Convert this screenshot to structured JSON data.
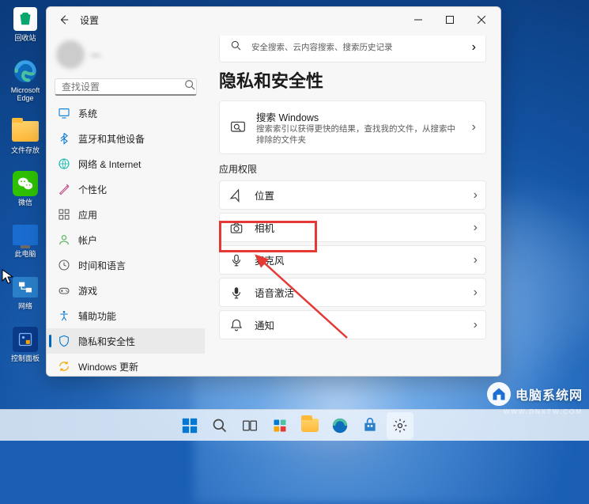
{
  "desktop": {
    "icons": [
      {
        "id": "recycle-bin",
        "label": "回收站"
      },
      {
        "id": "edge",
        "label": "Microsoft\nEdge"
      },
      {
        "id": "file-store",
        "label": "文件存放"
      },
      {
        "id": "wechat",
        "label": "微信"
      },
      {
        "id": "this-pc",
        "label": "此电脑"
      },
      {
        "id": "network",
        "label": "网络"
      },
      {
        "id": "control-panel",
        "label": "控制面板"
      }
    ]
  },
  "window": {
    "title": "设置",
    "search_placeholder": "查找设置",
    "user_name": "—",
    "nav": [
      {
        "icon": "system",
        "label": "系统",
        "color": "#0078d4"
      },
      {
        "icon": "bluetooth",
        "label": "蓝牙和其他设备",
        "color": "#0078d4"
      },
      {
        "icon": "network",
        "label": "网络 & Internet",
        "color": "#00b8a9"
      },
      {
        "icon": "personalize",
        "label": "个性化",
        "color": "#c04b8a"
      },
      {
        "icon": "apps",
        "label": "应用",
        "color": "#5b5b5b"
      },
      {
        "icon": "accounts",
        "label": "帐户",
        "color": "#4caf50"
      },
      {
        "icon": "time",
        "label": "时间和语言",
        "color": "#5b5b5b"
      },
      {
        "icon": "gaming",
        "label": "游戏",
        "color": "#5b5b5b"
      },
      {
        "icon": "accessibility",
        "label": "辅助功能",
        "color": "#0078d4"
      },
      {
        "icon": "privacy",
        "label": "隐私和安全性",
        "color": "#0078d4",
        "active": true
      },
      {
        "icon": "update",
        "label": "Windows 更新",
        "color": "#f7a500"
      }
    ],
    "page_title": "隐私和安全性",
    "top_snippet": "安全搜索、云内容搜索、搜索历史记录",
    "search_card": {
      "title": "搜索 Windows",
      "desc": "搜索索引以获得更快的结果，查找我的文件，从搜索中排除的文件夹"
    },
    "section_label": "应用权限",
    "permissions": [
      {
        "icon": "location",
        "label": "位置"
      },
      {
        "icon": "camera",
        "label": "相机"
      },
      {
        "icon": "microphone",
        "label": "麦克风",
        "highlighted": true
      },
      {
        "icon": "voice",
        "label": "语音激活"
      },
      {
        "icon": "notifications",
        "label": "通知"
      }
    ]
  },
  "watermark": {
    "text": "电脑系统网",
    "url": "WWW.DNXTW.COM"
  }
}
